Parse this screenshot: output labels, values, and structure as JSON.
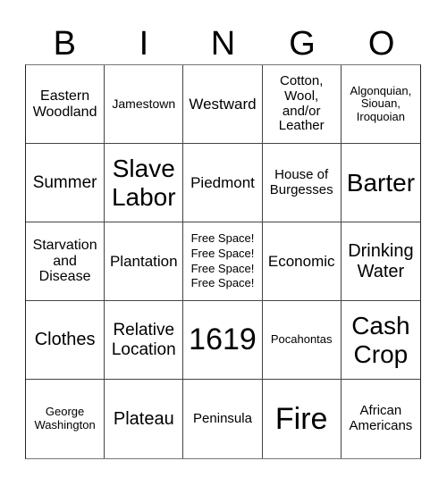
{
  "header": {
    "letters": [
      "B",
      "I",
      "N",
      "G",
      "O"
    ]
  },
  "cells": [
    "Eastern\nWoodland",
    "Jamestown",
    "Westward",
    "Cotton,\nWool,\nand/or\nLeather",
    "Algonquian,\nSiouan,\nIroquoian",
    "Summer",
    "Slave\nLabor",
    "Piedmont",
    "House of\nBurgesses",
    "Barter",
    "Starvation\nand\nDisease",
    "Plantation",
    "Free Space!\nFree Space!\nFree Space!\nFree Space!",
    "Economic",
    "Drinking\nWater",
    "Clothes",
    "Relative\nLocation",
    "1619",
    "Pocahontas",
    "Cash\nCrop",
    "George\nWashington",
    "Plateau",
    "Peninsula",
    "Fire",
    "African\nAmericans"
  ]
}
